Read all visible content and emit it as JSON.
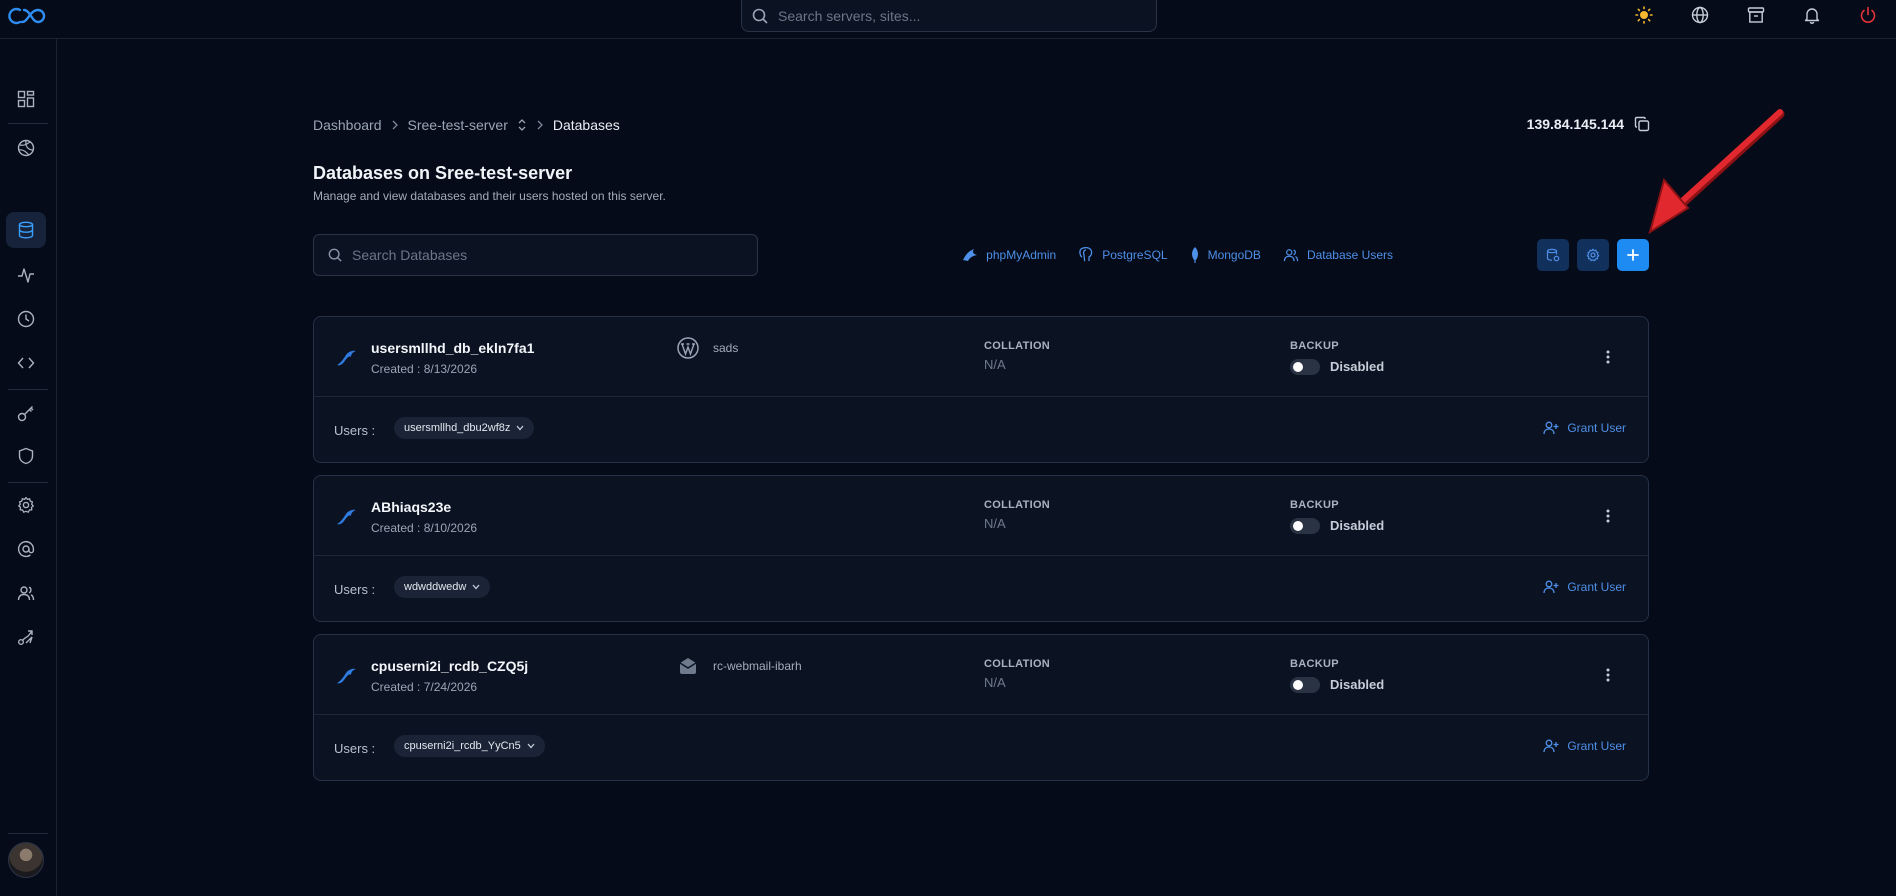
{
  "topbar": {
    "search_placeholder": "Search servers, sites...",
    "icons": [
      "sun-icon",
      "globe-icon",
      "archive-icon",
      "bell-icon",
      "power-icon"
    ]
  },
  "sidebar": {
    "items": [
      "dashboard-icon",
      "network-icon",
      "database-icon",
      "activity-icon",
      "clock-icon",
      "code-icon",
      "key-icon",
      "shield-icon",
      "settings-icon",
      "at-sign-icon",
      "users-icon",
      "route-icon"
    ],
    "active": "database-icon"
  },
  "breadcrumb": {
    "items": [
      "Dashboard",
      "Sree-test-server",
      "Databases"
    ]
  },
  "server_ip": "139.84.145.144",
  "page": {
    "title": "Databases on Sree-test-server",
    "subtitle": "Manage and view databases and their users hosted on this server."
  },
  "db_search": {
    "placeholder": "Search Databases"
  },
  "tools": {
    "phpmyadmin": "phpMyAdmin",
    "postgresql": "PostgreSQL",
    "mongodb": "MongoDB",
    "database_users": "Database Users"
  },
  "labels": {
    "collation": "COLLATION",
    "backup": "BACKUP",
    "users": "Users :",
    "grant_user": "Grant User"
  },
  "databases": [
    {
      "name": "usersmllhd_db_ekln7fa1",
      "created": "Created : 8/13/2026",
      "site": "sads",
      "site_icon": "wordpress-icon",
      "collation": "N/A",
      "backup": "Disabled",
      "user": "usersmllhd_dbu2wf8z"
    },
    {
      "name": "ABhiaqs23e",
      "created": "Created : 8/10/2026",
      "site": "",
      "collation": "N/A",
      "backup": "Disabled",
      "user": "wdwddwedw"
    },
    {
      "name": "cpuserni2i_rcdb_CZQ5j",
      "created": "Created : 7/24/2026",
      "site": "rc-webmail-ibarh",
      "site_icon": "webmail-icon",
      "collation": "N/A",
      "backup": "Disabled",
      "user": "cpuserni2i_rcdb_YyCn5"
    }
  ],
  "colors": {
    "background": "#050b18",
    "card": "#0b1322",
    "accent": "#1d8bf2",
    "link": "#4e8fe8",
    "arrow": "#e0282e"
  }
}
